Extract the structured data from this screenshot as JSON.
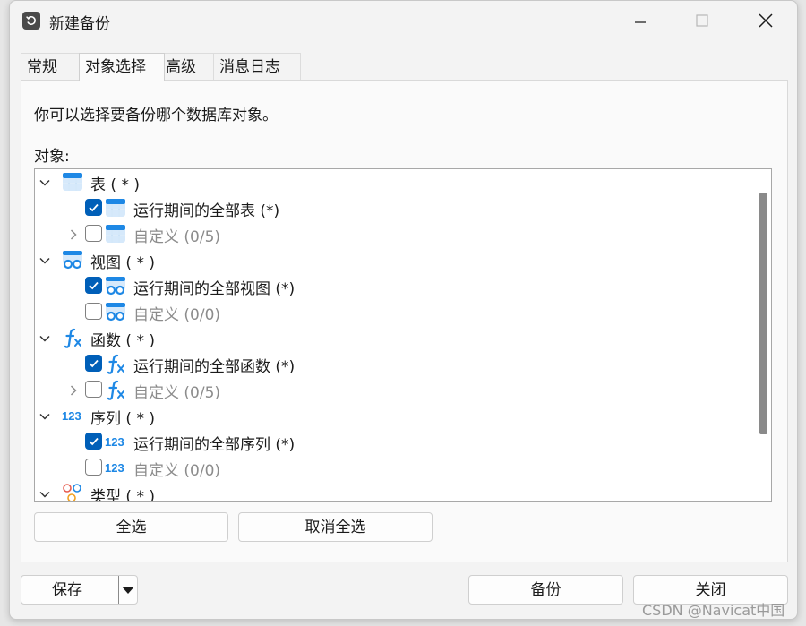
{
  "window": {
    "title": "新建备份",
    "icon": "backup-restore-icon",
    "controls": [
      "minimize-icon",
      "maximize-icon",
      "close-icon"
    ]
  },
  "tabs": [
    {
      "label": "常规",
      "active": false
    },
    {
      "label": "对象选择",
      "active": true
    },
    {
      "label": "高级",
      "active": false
    },
    {
      "label": "消息日志",
      "active": false
    }
  ],
  "panel": {
    "description": "你可以选择要备份哪个数据库对象。",
    "objects_label": "对象:"
  },
  "tree": [
    {
      "level": 0,
      "expand": "expanded",
      "checkbox": null,
      "icon": "table-icon",
      "label": "表 ( * )",
      "dim": false
    },
    {
      "level": 1,
      "expand": null,
      "checkbox": true,
      "icon": "table-icon",
      "label": "运行期间的全部表 (*)",
      "dim": false
    },
    {
      "level": 1,
      "expand": "collapsed",
      "checkbox": false,
      "icon": "table-icon",
      "label": "自定义 (0/5)",
      "dim": true
    },
    {
      "level": 0,
      "expand": "expanded",
      "checkbox": null,
      "icon": "view-icon",
      "label": "视图 ( * )",
      "dim": false
    },
    {
      "level": 1,
      "expand": null,
      "checkbox": true,
      "icon": "view-icon",
      "label": "运行期间的全部视图 (*)",
      "dim": false
    },
    {
      "level": 1,
      "expand": null,
      "checkbox": false,
      "icon": "view-icon",
      "label": "自定义 (0/0)",
      "dim": true
    },
    {
      "level": 0,
      "expand": "expanded",
      "checkbox": null,
      "icon": "function-icon",
      "label": "函数 ( * )",
      "dim": false
    },
    {
      "level": 1,
      "expand": null,
      "checkbox": true,
      "icon": "function-icon",
      "label": "运行期间的全部函数 (*)",
      "dim": false
    },
    {
      "level": 1,
      "expand": "collapsed",
      "checkbox": false,
      "icon": "function-icon",
      "label": "自定义 (0/5)",
      "dim": true
    },
    {
      "level": 0,
      "expand": "expanded",
      "checkbox": null,
      "icon": "sequence-icon",
      "label": "序列 ( * )",
      "dim": false
    },
    {
      "level": 1,
      "expand": null,
      "checkbox": true,
      "icon": "sequence-icon",
      "label": "运行期间的全部序列 (*)",
      "dim": false
    },
    {
      "level": 1,
      "expand": null,
      "checkbox": false,
      "icon": "sequence-icon",
      "label": "自定义 (0/0)",
      "dim": true
    },
    {
      "level": 0,
      "expand": "expanded",
      "checkbox": null,
      "icon": "type-icon",
      "label": "类型 ( * )",
      "dim": false
    }
  ],
  "buttons": {
    "select_all": "全选",
    "deselect_all": "取消全选",
    "save": "保存",
    "backup": "备份",
    "close": "关闭"
  },
  "watermark": "CSDN @Navicat中国",
  "colors": {
    "accent": "#005fb8",
    "icon_blue": "#1e88e5",
    "disabled_text": "#8c8c8c"
  }
}
